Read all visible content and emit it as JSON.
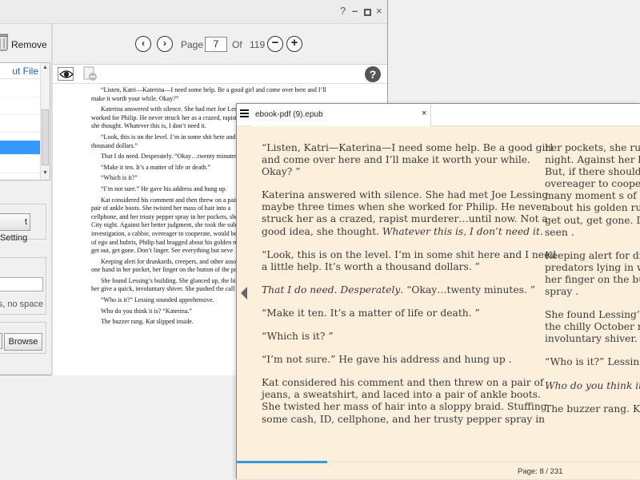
{
  "window": {
    "help_glyph": "?",
    "min_glyph": "–",
    "close_glyph": "×"
  },
  "left_panel": {
    "remove_label": "Remove",
    "list_header": "ut File",
    "setting_button": "t Setting",
    "output_hint": "ers, no space)",
    "browse_label": "Browse"
  },
  "toolbar": {
    "prev_glyph": "‹",
    "next_glyph": "›",
    "page_label": "Page",
    "current_page": "7",
    "of_label": "Of",
    "total_pages": "119",
    "zoom_out_glyph": "−",
    "zoom_in_glyph": "+"
  },
  "preview": {
    "help_glyph": "?",
    "paragraphs": [
      [
        "“Listen, Katri—Katerina—I need some help. Be a good girl and come over here and I’ll",
        "make it worth your while. Okay?”"
      ],
      [
        "Katerina answered with silence. She had met Joe Lessing",
        "worked for Philip. He never struck her as a crazed, rapist",
        "she thought. Whatever this is, I don’t need it."
      ],
      [
        "“Look, this is on the level. I’m in some shit here and",
        "thousand dollars.”"
      ],
      [
        "That I do need. Desperately. “Okay…twenty minutes.”"
      ],
      [
        "“Make it ten. It’s a matter of life or death.”"
      ],
      [
        "“Which is it?”"
      ],
      [
        "“I’m not sure.” He gave his address and hung up."
      ],
      [
        "Kat considered his comment and then threw on a pair",
        "pair of ankle boots. She twisted her mass of hair into a",
        "cellphone, and her trusty pepper spray in her pockets, she",
        "City night. Against her better judgment, she took the sub",
        "investigation, a cabbie, overeager to cooperate, would be",
        "of ego and hubris, Philip had bragged about his golden ru",
        "get out, get gone. Don’t linger. See everything but neve"
      ],
      [
        "Keeping alert for drunkards, creepers, and other asso",
        "one hand in her pocket, her finger on the button of the pa"
      ],
      [
        "She found Lessing’s building. She glanced up, the bi",
        "her give a quick, involuntary shiver. She pushed the call"
      ],
      [
        "“Who is it?” Lessing sounded apprehensive."
      ],
      [
        "Who do you think it is? “Katerina.”"
      ],
      [
        "The buzzer rang. Kat slipped inside."
      ]
    ]
  },
  "reader": {
    "tab_title": "ebook-pdf (9).epub",
    "tab_close": "×",
    "page_status": "Page: 8 / 231",
    "progress_fraction": 0.035,
    "accent_color": "#2f9bd9",
    "background_color": "#fcefdc",
    "col1": [
      {
        "lines": [
          "“Listen, Katri—Katerina—I need some help. Be a good  girl",
          "and come over here and I’ll make it worth your  while.",
          "Okay? ”"
        ]
      },
      {
        "lines": [
          "Katerina answered with silence. She had met Joe  Lessing",
          "maybe three times when she worked for Philip. He  never",
          "struck her as a crazed, rapist murderer…until now. Not  a"
        ],
        "tail": "good idea, she thought. ",
        "tail_em": "Whatever this is, I don’t need it",
        "tail_end": "."
      },
      {
        "lines": [
          "“Look, this is on the level. I’m in some shit here and I  need",
          "a little help. It’s worth a thousand dollars. ”"
        ]
      },
      {
        "em": "That I do need. Desperately",
        "rest": ". “Okay…twenty minutes. ”"
      },
      {
        "lines": [
          "“Make it ten. It’s a matter of life or death. ”"
        ]
      },
      {
        "lines": [
          "“Which is it? ”"
        ]
      },
      {
        "lines": [
          "“I’m not sure.” He gave his address and hung up ."
        ]
      },
      {
        "lines": [
          "Kat considered his comment and then threw on a pair  of",
          "jeans, a sweatshirt, and laced into a pair of ankle  boots.",
          "She twisted her mass of hair into a sloppy braid.  Stuffing",
          "some cash, ID, cellphone, and her trusty pepper spray  in"
        ]
      }
    ],
    "col2": [
      {
        "lines": [
          "her pockets, she rush",
          "night. Against her be",
          "But, if there should",
          "overeager to cooperat",
          "many moment s of e",
          "about his golden rule",
          "get out, get gone. Dor",
          "seen ."
        ]
      },
      {
        "lines": [
          "Keeping alert for dru",
          "predators lying in wa",
          "her finger on the but",
          "spray ."
        ]
      },
      {
        "lines": [
          "She found Lessing’s b",
          "the chilly October n",
          "involuntary shiver. Sh"
        ]
      },
      {
        "lines": [
          "“Who is it?” Lessing"
        ]
      },
      {
        "em": "Who do you think it i"
      },
      {
        "lines": [
          "The buzzer rang. Kat"
        ]
      }
    ]
  }
}
